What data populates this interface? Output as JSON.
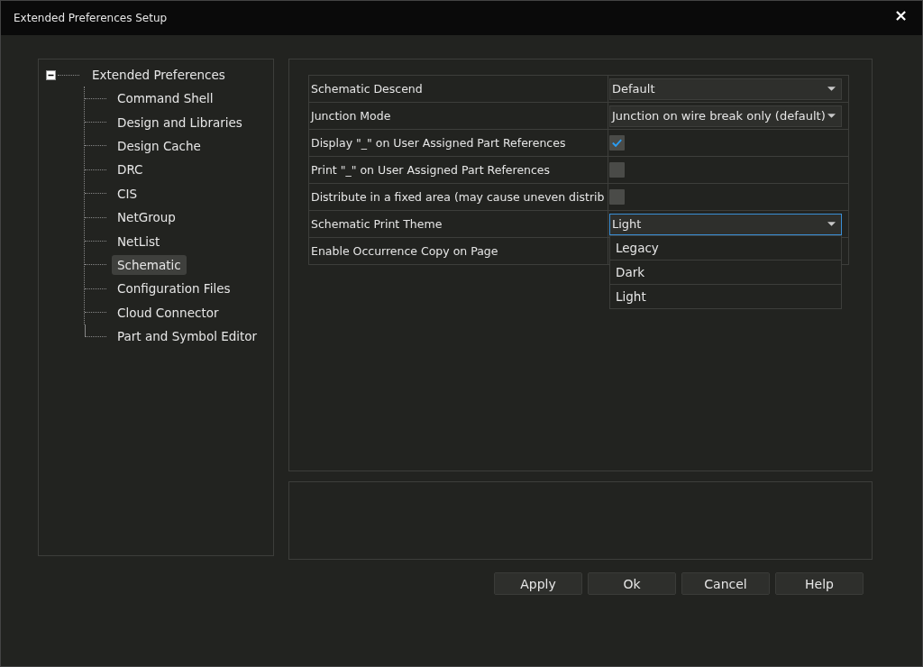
{
  "window": {
    "title": "Extended Preferences Setup",
    "close": "×"
  },
  "tree": {
    "label": "Extended Preferences",
    "expanded": true,
    "children": [
      {
        "label": "Command Shell",
        "selected": false
      },
      {
        "label": "Design and Libraries",
        "selected": false
      },
      {
        "label": "Design Cache",
        "selected": false
      },
      {
        "label": "DRC",
        "selected": false
      },
      {
        "label": "CIS",
        "selected": false
      },
      {
        "label": "NetGroup",
        "selected": false
      },
      {
        "label": "NetList",
        "selected": false
      },
      {
        "label": "Schematic",
        "selected": true
      },
      {
        "label": "Configuration Files",
        "selected": false
      },
      {
        "label": "Cloud Connector",
        "selected": false
      },
      {
        "label": "Part and Symbol Editor",
        "selected": false
      }
    ]
  },
  "properties": [
    {
      "kind": "dropdown",
      "label": "Schematic Descend",
      "value": "Default",
      "open": false
    },
    {
      "kind": "dropdown",
      "label": "Junction Mode",
      "value": "Junction on wire break only (default)",
      "open": false
    },
    {
      "kind": "checkbox",
      "label": "Display \"_\" on User Assigned Part References",
      "checked": true
    },
    {
      "kind": "checkbox",
      "label": "Print \"_\" on User Assigned Part References",
      "checked": false
    },
    {
      "kind": "checkbox",
      "label": "Distribute in a fixed area (may cause uneven distrib",
      "checked": false
    },
    {
      "kind": "dropdown",
      "label": "Schematic Print Theme",
      "value": "Light",
      "open": true,
      "options": [
        "Legacy",
        "Dark",
        "Light"
      ]
    },
    {
      "kind": "text",
      "label": "Enable Occurrence Copy on Page"
    }
  ],
  "buttons": [
    "Apply",
    "Ok",
    "Cancel",
    "Help"
  ]
}
